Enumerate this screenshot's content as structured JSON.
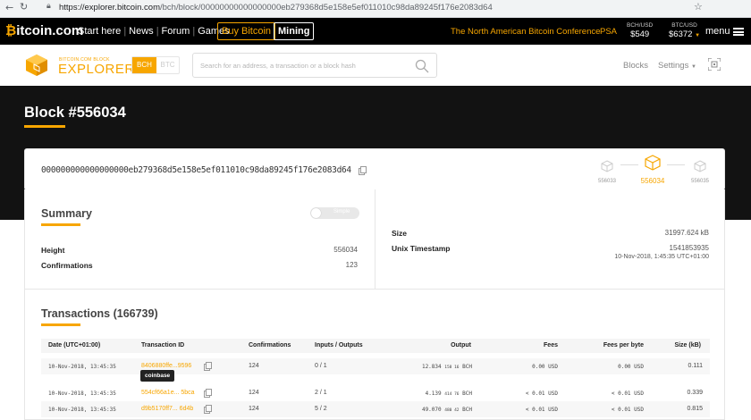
{
  "browser": {
    "url_domain": "https://explorer.bitcoin.com",
    "url_path": "/bch/block/00000000000000000eb279368d5e158e5ef011010c98da89245f176e2083d64"
  },
  "topnav": {
    "logo_symbol": "₿",
    "logo_text": "itcoin.com",
    "links": [
      "Start here",
      "News",
      "Forum",
      "Games"
    ],
    "buy_label": "Buy Bitcoin",
    "mining_label": "Mining",
    "conference_label": "The North American Bitcoin Conference",
    "psa_label": "PSA",
    "prices": [
      {
        "label": "BCH/USD",
        "value": "$549"
      },
      {
        "label": "BTC/USD",
        "value": "$6372"
      }
    ],
    "menu_label": "menu",
    "accent": "#f7a600"
  },
  "explorer": {
    "logo_small": "BITCOIN.COM BLOCK",
    "logo_big": "EXPLORER",
    "chains": [
      "BCH",
      "BTC"
    ],
    "search_placeholder": "Search for an address, a transaction or a block hash",
    "blocks_label": "Blocks",
    "settings_label": "Settings"
  },
  "block": {
    "title": "Block #556034",
    "hash": "000000000000000000eb279368d5e158e5ef011010c98da89245f176e2083d64",
    "prev": "556033",
    "current": "556034",
    "next": "556035"
  },
  "summary": {
    "title": "Summary",
    "toggle_label": "Simple",
    "height_label": "Height",
    "height_value": "556034",
    "confirmations_label": "Confirmations",
    "confirmations_value": "123",
    "size_label": "Size",
    "size_value": "31997.624 kB",
    "timestamp_label": "Unix Timestamp",
    "timestamp_value": "1541853935",
    "timestamp_date": "10-Nov-2018, 1:45:35 UTC+01:00"
  },
  "transactions": {
    "title": "Transactions (166739)",
    "columns": [
      "Date (UTC+01:00)",
      "Transaction ID",
      "Confirmations",
      "Inputs / Outputs",
      "Output",
      "Fees",
      "Fees per byte",
      "Size (kB)"
    ],
    "coinbase_label": "coinbase",
    "rows": [
      {
        "date": "10-Nov-2018, 13:45:35",
        "txid": "8406880ffe...9596",
        "confirmations": "124",
        "io": "0 / 1",
        "output_main": "12.834",
        "output_small": "158 16",
        "output_unit": "BCH",
        "fees": "0.00 USD",
        "fpb": "0.00 USD",
        "size": "0.111"
      },
      {
        "date": "10-Nov-2018, 13:45:35",
        "txid": "554cf66a1e... 5bca",
        "confirmations": "124",
        "io": "2 / 1",
        "output_main": "4.139",
        "output_small": "414 76",
        "output_unit": "BCH",
        "fees": "< 0.01 USD",
        "fpb": "< 0.01 USD",
        "size": "0.339"
      },
      {
        "date": "10-Nov-2018, 13:45:35",
        "txid": "d9b5170ff7... 6d4b",
        "confirmations": "124",
        "io": "5 / 2",
        "output_main": "49.070",
        "output_small": "480 42",
        "output_unit": "BCH",
        "fees": "< 0.01 USD",
        "fpb": "< 0.01 USD",
        "size": "0.815"
      }
    ]
  }
}
